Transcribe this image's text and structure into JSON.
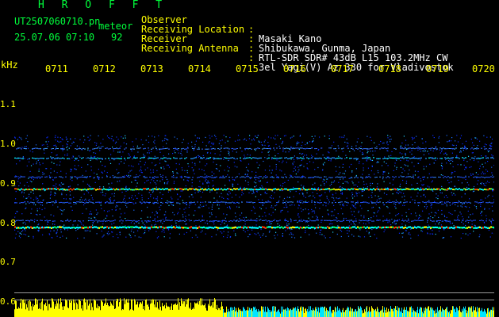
{
  "header": {
    "title": "H R O F F T",
    "filename": "UT2507060710.pn",
    "tag": "meteor",
    "datetime": "25.07.06 07:10",
    "count": "92",
    "fields": [
      {
        "label": "Observer",
        "value": "Masaki Kano"
      },
      {
        "label": "Receiving Location",
        "value": "Shibukawa, Gunma, Japan"
      },
      {
        "label": "Receiver",
        "value": "RTL-SDR SDR# 43dB L15 103.2MHz CW"
      },
      {
        "label": "Receiving Antenna",
        "value": "3el Yagi(V) Az 330 for Vladivostok"
      }
    ],
    "separator": ":"
  },
  "axes": {
    "y_unit": "kHz",
    "y_ticks": [
      "1.1",
      "1.0",
      "0.9",
      "0.8",
      "0.7",
      "0.6"
    ],
    "x_ticks": [
      "0711",
      "0712",
      "0713",
      "0714",
      "0715",
      "0716",
      "0717",
      "0718",
      "0719",
      "0720"
    ]
  },
  "colors": {
    "header_green": "#00ff3c",
    "label_yellow": "#ffff00",
    "value_white": "#ffffff",
    "background": "#000000",
    "signal_bar_yellow": "#ffff00",
    "signal_bar_cyan": "#00e5ff"
  }
}
